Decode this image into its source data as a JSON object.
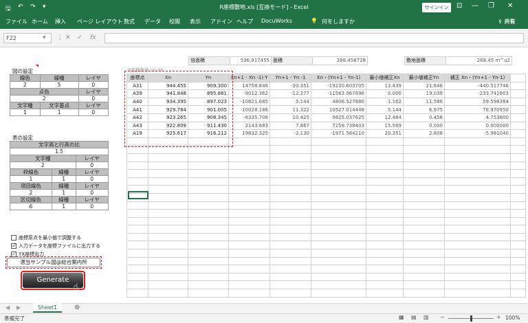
{
  "title_bar": {
    "title": "R座標敷地.xls [互換モード] - Excel",
    "signin": "サインイン",
    "save_icon": "save-icon",
    "undo_icon": "undo-icon",
    "redo_icon": "redo-icon"
  },
  "ribbon": {
    "tabs": [
      "ファイル",
      "ホーム",
      "挿入",
      "ページ レイアウト",
      "数式",
      "データ",
      "校閲",
      "表示",
      "アドイン",
      "ヘルプ",
      "DocuWorks"
    ],
    "tell_me": "何をしますか",
    "share": "共有"
  },
  "formula_bar": {
    "name_box": "F22",
    "fx": "fx",
    "content": ""
  },
  "left_panel": {
    "drawing_settings_title": "図の設定",
    "drawing_headers": [
      "線色",
      "線種",
      "レイヤ"
    ],
    "drawing_values": [
      "2",
      "5",
      "0"
    ],
    "point_color_label": "点色",
    "layer_label": "レイヤ",
    "point_color_values": [
      "2",
      "0"
    ],
    "char_headers": [
      "文字種",
      "文字基点",
      "レイヤ"
    ],
    "char_values": [
      "1",
      "1",
      "0"
    ],
    "table_settings_title": "表の設定",
    "ratio_label": "文字高と行高の比",
    "ratio_value": "1.5",
    "text_type_label": "文字種",
    "text_type_value": "2",
    "text_layer_value": "0",
    "frame_headers": [
      "枠線色",
      "線種",
      "レイヤ"
    ],
    "frame_values": [
      "1",
      "1",
      "0"
    ],
    "item_headers": [
      "項目線色",
      "線種",
      "レイヤ"
    ],
    "item_values": [
      "2",
      "1",
      "0"
    ],
    "section_headers": [
      "区切線色",
      "線種",
      "レイヤ"
    ],
    "section_values": [
      "6",
      "1",
      "0"
    ],
    "checkboxes": [
      {
        "label": "座標原点を最小値で調整する",
        "checked": false
      },
      {
        "label": "入力データを座標ファイルに出力する",
        "checked": true
      },
      {
        "label": "YX座標出力",
        "checked": true
      }
    ],
    "dropdown_value": "適当サンプル図@総合案内所",
    "generate_label": "Generate"
  },
  "summary": {
    "label1": "倍面積",
    "value1": "536.917455",
    "label2": "面積",
    "value2": "268.458728",
    "label3": "敷地面積",
    "value3": "268.45 m^u2"
  },
  "watermark": "R座標数地 V0.06",
  "table": {
    "headers": [
      "座標点",
      "Xn",
      "Yn",
      "Xn+1 - Xn -1)·Y",
      "Yn+1 - Yn -1",
      "Xn・(Yn+1 - Yn-1)",
      "最小値補正Xn",
      "最小値補正Yn",
      "補正 Xn・(Yn+1 - Yn-1)"
    ],
    "rows": [
      [
        "A31",
        "944.455",
        "909.300",
        "14758.848",
        "-20.351",
        "-19220.603705",
        "13.439",
        "21.646",
        "-440.517746"
      ],
      [
        "A39",
        "941.848",
        "895.861",
        "-9012.362",
        "-12.277",
        "-11563.067896",
        "0.000",
        "19.039",
        "-233.741803"
      ],
      [
        "A40",
        "934.395",
        "897.023",
        "-10821.685",
        "5.144",
        "4806.527880",
        "1.162",
        "11.586",
        "59.598384"
      ],
      [
        "A41",
        "929.784",
        "901.005",
        "-10028.186",
        "11.322",
        "10527.014448",
        "5.144",
        "6.975",
        "78.970950"
      ],
      [
        "A42",
        "923.265",
        "908.345",
        "-6335.706",
        "10.425",
        "9625.037625",
        "12.484",
        "0.456",
        "4.753800"
      ],
      [
        "A43",
        "922.809",
        "911.430",
        "2143.683",
        "7.867",
        "7259.738403",
        "15.569",
        "0.000",
        "0.000000"
      ],
      [
        "A19",
        "925.617",
        "916.212",
        "19832.325",
        "-2.130",
        "-1971.564210",
        "20.351",
        "2.808",
        "-5.981040"
      ]
    ]
  },
  "sheet_tabs": [
    "Sheet1"
  ],
  "status": {
    "left": "準備完了",
    "zoom": "100%"
  }
}
